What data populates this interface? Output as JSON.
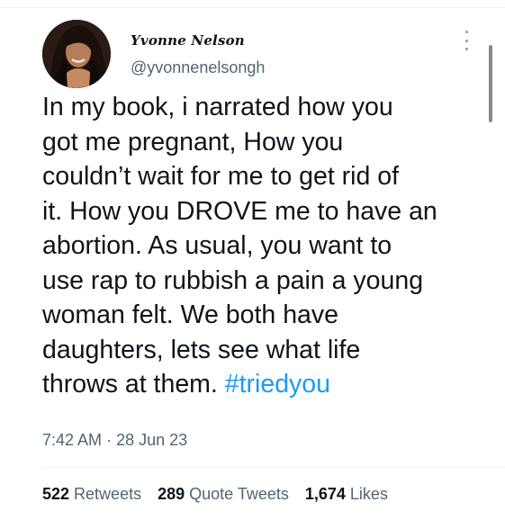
{
  "tweet": {
    "author_name": "Yvonne Nelson",
    "author_handle": "@yvonnenelsongh",
    "text_lines": [
      "In my book, i narrated how you",
      "got me pregnant, How you",
      "couldn’t wait for me to get rid of",
      "it. How you DROVE me to have an",
      "abortion. As usual, you want to",
      "use rap to rubbish a pain a young",
      "woman felt. We both have",
      "daughters, lets see what life",
      "throws at them. "
    ],
    "hashtag": "#triedyou",
    "time": "7:42 AM",
    "separator": "·",
    "date": "28 Jun 23"
  },
  "stats": {
    "retweets_count": "522",
    "retweets_label": "Retweets",
    "quote_tweets_count": "289",
    "quote_tweets_label": "Quote Tweets",
    "likes_count": "1,674",
    "likes_label": "Likes"
  },
  "icons": {
    "avatar": "profile-photo",
    "more": "more-options-icon"
  },
  "colors": {
    "hashtag": "#1d9bf0",
    "secondary_text": "#536471",
    "primary_text": "#0f1419"
  }
}
